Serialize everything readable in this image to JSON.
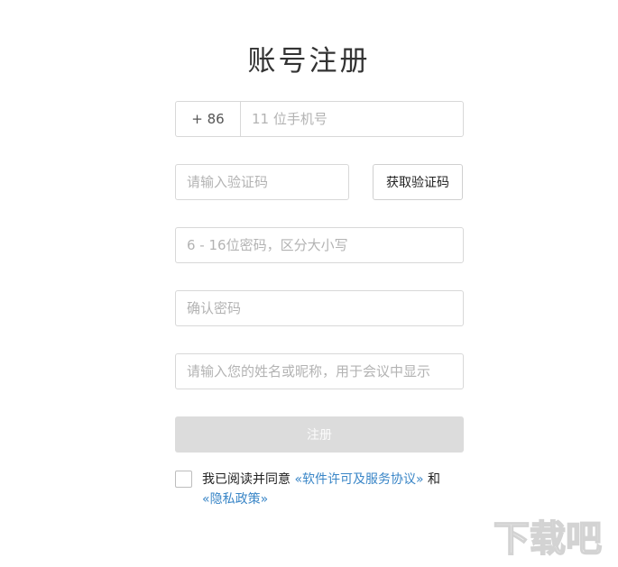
{
  "page": {
    "title": "账号注册"
  },
  "form": {
    "country_code": "+ 86",
    "phone_placeholder": "11 位手机号",
    "code_placeholder": "请输入验证码",
    "get_code_label": "获取验证码",
    "password_placeholder": "6 - 16位密码，区分大小写",
    "confirm_placeholder": "确认密码",
    "name_placeholder": "请输入您的姓名或昵称，用于会议中显示",
    "submit_label": "注册"
  },
  "agreement": {
    "prefix": "我已阅读并同意",
    "license_link": "«软件许可及服务协议»",
    "conjunction": "和",
    "privacy_link": "«隐私政策»",
    "checked": false
  },
  "watermark": {
    "text": "下载吧"
  },
  "colors": {
    "link": "#3a86c7",
    "button_disabled": "#dcdcdc",
    "border": "#d8d8d8"
  }
}
